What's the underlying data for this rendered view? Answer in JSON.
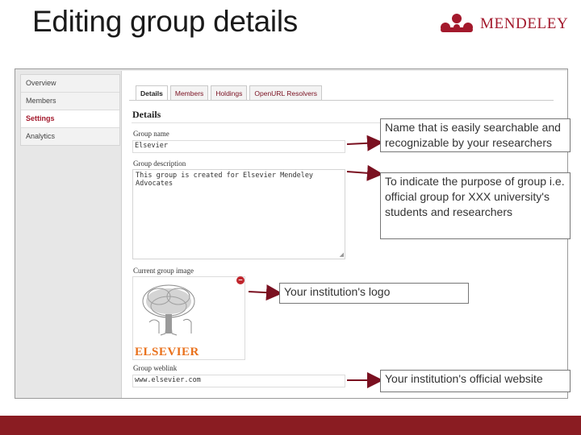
{
  "slide": {
    "title": "Editing group details",
    "logo_text": "MENDELEY"
  },
  "sidebar": {
    "items": [
      {
        "label": "Overview"
      },
      {
        "label": "Members"
      },
      {
        "label": "Settings",
        "active": true
      },
      {
        "label": "Analytics"
      }
    ]
  },
  "tabs": [
    {
      "label": "Details",
      "active": true
    },
    {
      "label": "Members"
    },
    {
      "label": "Holdings"
    },
    {
      "label": "OpenURL Resolvers"
    }
  ],
  "details": {
    "section_title": "Details",
    "group_name_label": "Group name",
    "group_name_value": "Elsevier",
    "group_description_label": "Group description",
    "group_description_value": "This group is created for Elsevier Mendeley Advocates",
    "group_image_label": "Current group image",
    "group_image_logo_text": "ELSEVIER",
    "group_weblink_label": "Group weblink",
    "group_weblink_value": "www.elsevier.com"
  },
  "callouts": {
    "name": "Name that is easily searchable and recognizable by your researchers",
    "description": "To indicate the purpose of group i.e. official group for XXX university's students and researchers",
    "logo": "Your institution's logo",
    "website": "Your institution's official website"
  },
  "colors": {
    "brand": "#a3192c",
    "footer": "#8a1c22",
    "arrow": "#7a1020",
    "elsevier_orange": "#e9711c"
  },
  "icons": {
    "remove": "remove-circle-icon",
    "logo_mark": "mendeley-logo-icon",
    "tree": "elsevier-tree-icon"
  }
}
